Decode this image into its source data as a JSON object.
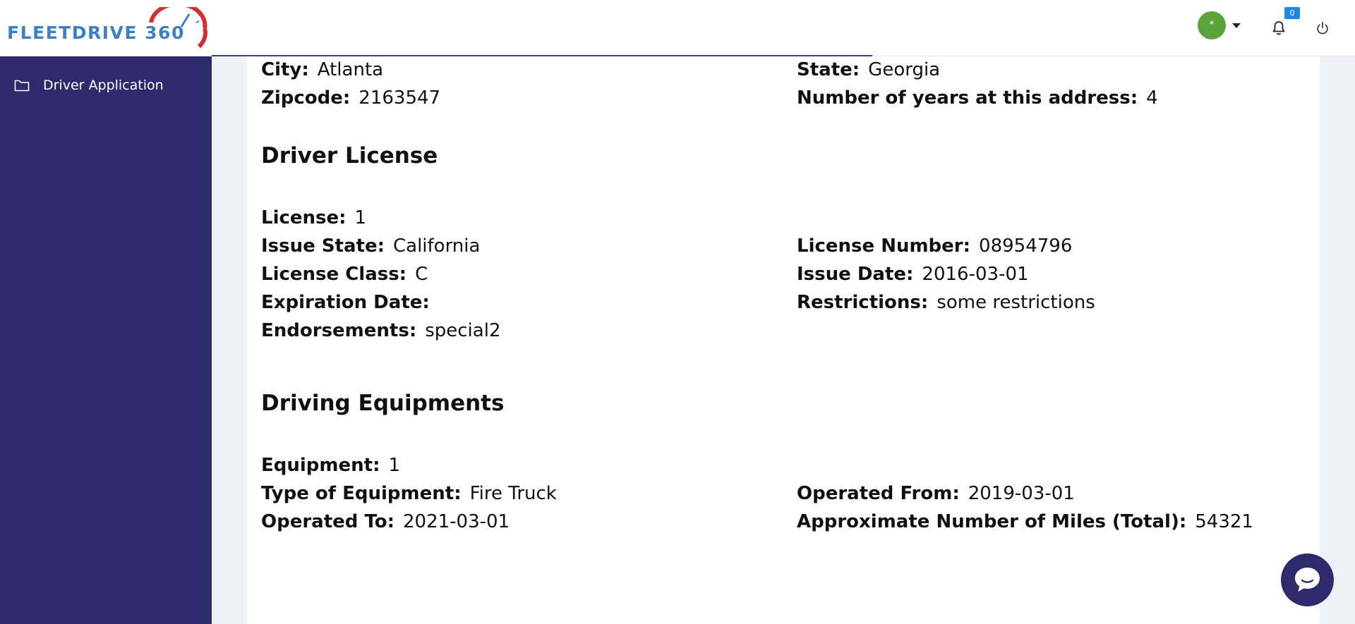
{
  "header": {
    "logo_text": "FLEETDRIVE 360",
    "avatar_symbol": "*",
    "notifications_count": "0",
    "colors": {
      "brand_blue": "#3f7fc4",
      "brand_red": "#d32f2f",
      "avatar_green": "#5aa33a",
      "badge_blue": "#1e88e5"
    }
  },
  "sidebar": {
    "background": "#2d2b6b",
    "items": [
      {
        "label": "Driver Application",
        "icon": "folder-icon"
      }
    ]
  },
  "address": {
    "city_label": "City:",
    "city": "Atlanta",
    "state_label": "State:",
    "state": "Georgia",
    "zip_label": "Zipcode:",
    "zip": "2163547",
    "years_label": "Number of years at this address:",
    "years": "4"
  },
  "license_section": {
    "title": "Driver License",
    "license_label": "License:",
    "license": "1",
    "issue_state_label": "Issue State:",
    "issue_state": "California",
    "license_number_label": "License Number:",
    "license_number": "08954796",
    "class_label": "License Class:",
    "class": "C",
    "issue_date_label": "Issue Date:",
    "issue_date": "2016-03-01",
    "expiration_label": "Expiration Date:",
    "expiration": "",
    "restrictions_label": "Restrictions:",
    "restrictions": "some restrictions",
    "endorsements_label": "Endorsements:",
    "endorsements": "special2"
  },
  "equipment_section": {
    "title": "Driving Equipments",
    "equipment_label": "Equipment:",
    "equipment": "1",
    "type_label": "Type of Equipment:",
    "type": "Fire Truck",
    "from_label": "Operated From:",
    "from": "2019-03-01",
    "to_label": "Operated To:",
    "to": "2021-03-01",
    "miles_label": "Approximate Number of Miles (Total):",
    "miles": "54321"
  },
  "chat": {
    "icon": "chat-bubble-icon"
  }
}
